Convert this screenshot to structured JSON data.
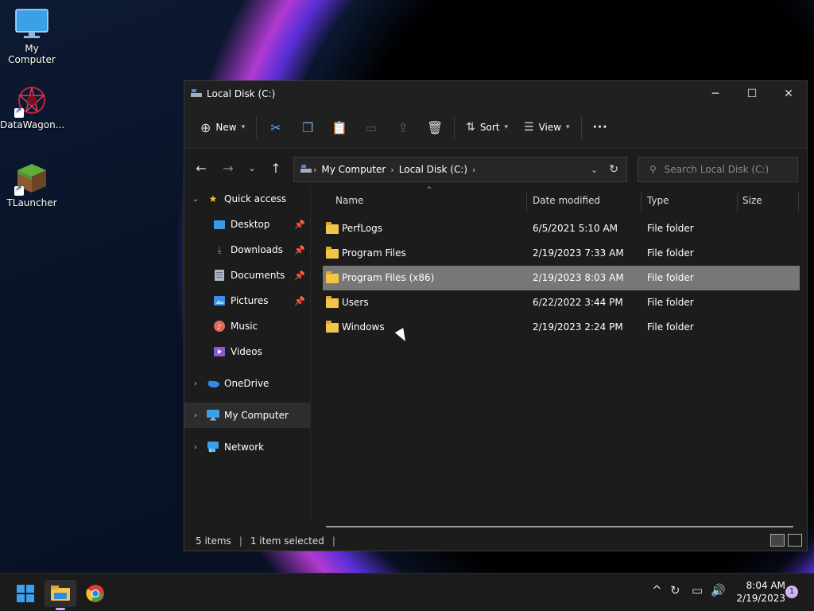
{
  "desktop": {
    "icons": [
      {
        "label": "My Computer"
      },
      {
        "label": "DataWagon..."
      },
      {
        "label": "TLauncher"
      }
    ]
  },
  "window": {
    "title": "Local Disk (C:)",
    "toolbar": {
      "new_label": "New",
      "sort_label": "Sort",
      "view_label": "View",
      "more_label": "···"
    },
    "address": {
      "crumbs": [
        "My Computer",
        "Local Disk (C:)"
      ]
    },
    "search": {
      "placeholder": "Search Local Disk (C:)"
    },
    "sidebar": {
      "quick_access": "Quick access",
      "pinned": [
        {
          "label": "Desktop"
        },
        {
          "label": "Downloads"
        },
        {
          "label": "Documents"
        },
        {
          "label": "Pictures"
        },
        {
          "label": "Music"
        },
        {
          "label": "Videos"
        }
      ],
      "onedrive": "OneDrive",
      "my_computer": "My Computer",
      "network": "Network"
    },
    "columns": {
      "name": "Name",
      "date": "Date modified",
      "type": "Type",
      "size": "Size"
    },
    "rows": [
      {
        "name": "PerfLogs",
        "date": "6/5/2021 5:10 AM",
        "type": "File folder"
      },
      {
        "name": "Program Files",
        "date": "2/19/2023 7:33 AM",
        "type": "File folder"
      },
      {
        "name": "Program Files (x86)",
        "date": "2/19/2023 8:03 AM",
        "type": "File folder"
      },
      {
        "name": "Users",
        "date": "6/22/2022 3:44 PM",
        "type": "File folder"
      },
      {
        "name": "Windows",
        "date": "2/19/2023 2:24 PM",
        "type": "File folder"
      }
    ],
    "status": {
      "items": "5 items",
      "selected": "1 item selected"
    }
  },
  "taskbar": {
    "time": "8:04 AM",
    "date": "2/19/2023",
    "notifications": "1"
  }
}
